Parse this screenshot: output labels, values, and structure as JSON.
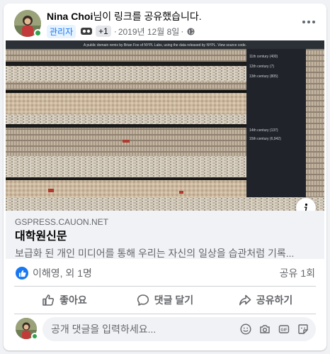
{
  "post": {
    "author": "Nina Choi",
    "action_text": "님이 링크를 공유했습니다.",
    "role_badge": "관리자",
    "plus_count": "+1",
    "date": "2019년 12월 8일",
    "separator": "·"
  },
  "link": {
    "domain": "GSPRESS.CAUON.NET",
    "title": "대학원신문",
    "description": "보급화 된 개인 미디어를 통해 우리는 자신의 일상을 습관처럼 기록...",
    "image": {
      "caption": "A public domain remix by Brian Foo of NYPL Labs, using the data released by NYPL.  View source code.",
      "legend": [
        "11th century (400)",
        "12th century (7)",
        "13th century (805)",
        "14th century (137)",
        "15th century (6,942)"
      ]
    }
  },
  "reactions": {
    "reactors": "이해영, 외 1명",
    "shares": "공유 1회"
  },
  "actions": {
    "like": "좋아요",
    "comment": "댓글 달기",
    "share": "공유하기"
  },
  "composer": {
    "placeholder": "공개 댓글을 입력하세요..."
  },
  "colors": {
    "brand_blue": "#1877f2",
    "online_green": "#31a24c",
    "secondary_text": "#65676b"
  }
}
